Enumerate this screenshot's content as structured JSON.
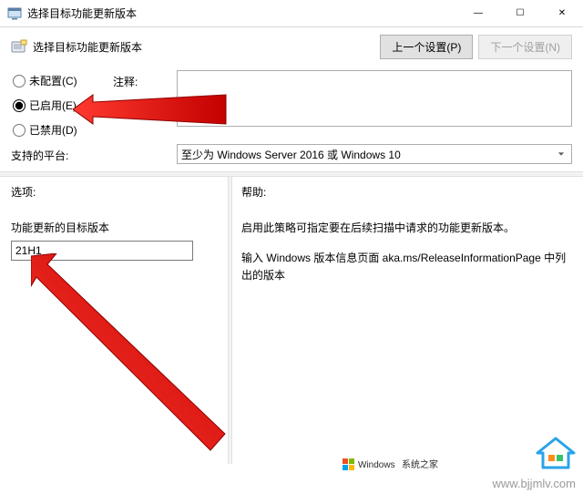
{
  "window": {
    "title": "选择目标功能更新版本",
    "minimize": "—",
    "maximize": "☐",
    "close": "✕"
  },
  "header": {
    "title": "选择目标功能更新版本",
    "prev_btn": "上一个设置(P)",
    "next_btn": "下一个设置(N)"
  },
  "config": {
    "radios": {
      "not_configured": "未配置(C)",
      "enabled": "已启用(E)",
      "disabled": "已禁用(D)",
      "selected": "enabled"
    },
    "comment_label": "注释:",
    "comment_value": "",
    "platform_label": "支持的平台:",
    "platform_value": "至少为 Windows Server 2016 或 Windows 10"
  },
  "options": {
    "heading": "选项:",
    "field_label": "功能更新的目标版本",
    "field_value": "21H1"
  },
  "help": {
    "heading": "帮助:",
    "p1": "启用此策略可指定要在后续扫描中请求的功能更新版本。",
    "p2": "输入 Windows 版本信息页面 aka.ms/ReleaseInformationPage 中列出的版本"
  },
  "watermark": {
    "logo_text": "Windows系统之家",
    "url": "www.bjjmlv.com"
  }
}
